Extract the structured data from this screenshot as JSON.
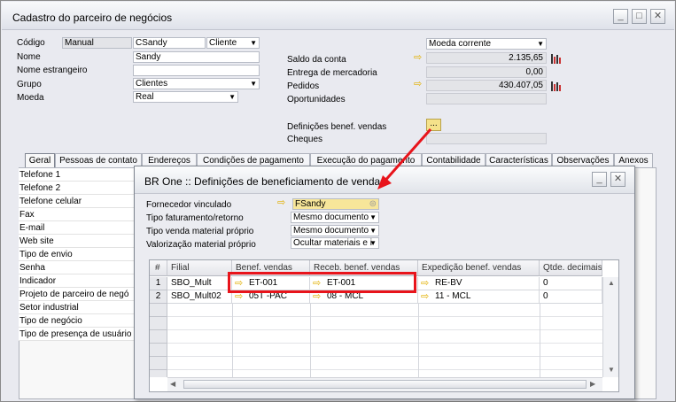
{
  "window": {
    "title": "Cadastro do parceiro de negócios",
    "buttons": [
      "_",
      "□",
      "✕"
    ]
  },
  "header": {
    "codigo_label": "Código",
    "codigo_series": "Manual",
    "codigo_value": "CSandy",
    "tipo_value": "Cliente",
    "nome_label": "Nome",
    "nome_value": "Sandy",
    "nome_estrangeiro_label": "Nome estrangeiro",
    "nome_estrangeiro_value": "",
    "grupo_label": "Grupo",
    "grupo_value": "Clientes",
    "moeda_label": "Moeda",
    "moeda_value": "Real",
    "moeda_corrente": "Moeda corrente",
    "saldo_label": "Saldo da conta",
    "saldo_value": "2.135,65",
    "entrega_label": "Entrega de mercadoria",
    "entrega_value": "0,00",
    "pedidos_label": "Pedidos",
    "pedidos_value": "430.407,05",
    "oportunidades_label": "Oportunidades",
    "definicoes_label": "Definições benef. vendas",
    "definicoes_btn": "...",
    "cheques_label": "Cheques"
  },
  "tabs": [
    "Geral",
    "Pessoas de contato",
    "Endereços",
    "Condições de pagamento",
    "Execução do pagamento",
    "Contabilidade",
    "Características",
    "Observações",
    "Anexos"
  ],
  "side_items": [
    "Telefone 1",
    "Telefone 2",
    "Telefone celular",
    "Fax",
    "E-mail",
    "Web site",
    "Tipo de envio",
    "Senha",
    "Indicador",
    "Projeto de parceiro de negó",
    "Setor industrial",
    "Tipo de negócio",
    "Tipo de presença de usuário"
  ],
  "dialog": {
    "title": "BR One :: Definições de beneficiamento de vendas",
    "fornecedor_label": "Fornecedor vinculado",
    "fornecedor_value": "FSandy",
    "tipo_fat_label": "Tipo faturamento/retorno",
    "tipo_fat_value": "Mesmo documento",
    "tipo_venda_label": "Tipo venda material próprio",
    "tipo_venda_value": "Mesmo documento",
    "valorizacao_label": "Valorização material próprio",
    "valorizacao_value": "Ocultar materiais e i",
    "grid": {
      "columns": [
        "#",
        "Filial",
        "Benef. vendas",
        "Receb. benef. vendas",
        "Expedição benef. vendas",
        "Qtde. decimais"
      ],
      "rows": [
        [
          "1",
          "SBO_Mult",
          "ET-001",
          "ET-001",
          "RE-BV",
          "0"
        ],
        [
          "2",
          "SBO_Mult02",
          "05T -PAC",
          "08 - MCL",
          "11 - MCL",
          "0"
        ]
      ]
    }
  },
  "colors": {
    "highlight_box": "#e8141b",
    "callout_arrow": "#e8141b",
    "link_arrow": "#e2b000",
    "fornecedor_bg": "#f7e69a"
  }
}
